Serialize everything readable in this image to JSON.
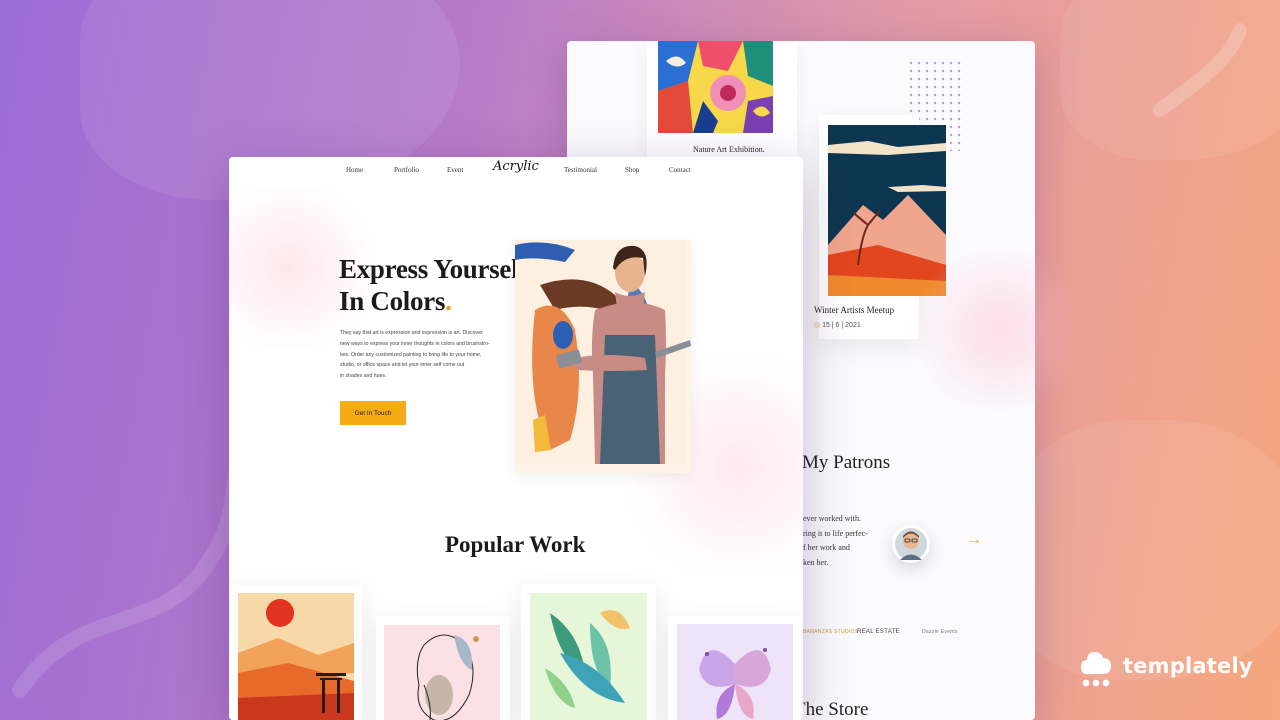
{
  "back_page": {
    "event1_title": "Nature Art Exhibition.",
    "event2_title": "Winter Artists Meetup",
    "event2_date": "15 | 6 | 2021",
    "patrons_title": "My Patrons",
    "patron_quote_lines": [
      "ever worked with.",
      "ring it to life perfec-",
      "f her work and",
      "ken her."
    ],
    "patron_logos": [
      "BANANZAS STUDIOS",
      "REAL ESTATE",
      "Dazzle Events"
    ],
    "store_title": "The Store"
  },
  "front_page": {
    "nav": {
      "home": "Home",
      "portfolio": "Portfolio",
      "event": "Event",
      "brand": "Acrylic",
      "testimonial": "Testimonial",
      "shop": "Shop",
      "contact": "Contact"
    },
    "hero": {
      "title": "Express Yourself\nIn Colors",
      "title_accent": ".",
      "text_lines": [
        "They say that art is expression and expression is art. Discover",
        "new ways to express your inner thoughts in colors and brushstro-",
        "kes. Order any customized painting to bring life to your home,",
        "studio, or office space and let your inner self come out",
        "in shades and hues."
      ],
      "cta_label": "Get In Touch"
    },
    "popular_work_title": "Popular Work"
  },
  "brand_badge": {
    "name": "templately"
  },
  "colors": {
    "accent": "#f5ac14",
    "bg_start": "#9b6bd6",
    "bg_end": "#f6a77e"
  }
}
